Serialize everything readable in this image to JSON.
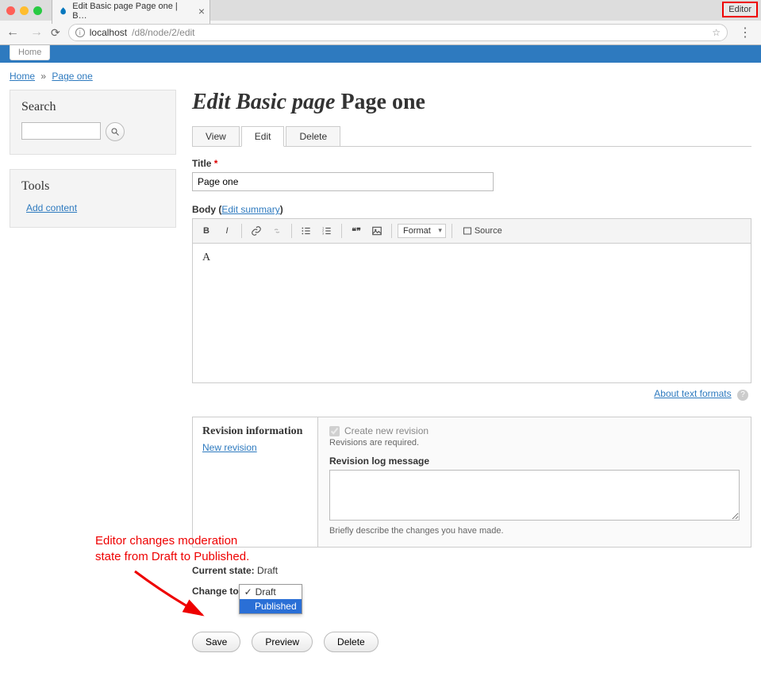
{
  "browser": {
    "tab_title": "Edit Basic page Page one | B…",
    "url_host": "localhost",
    "url_path": "/d8/node/2/edit",
    "editor_badge": "Editor"
  },
  "toolbar": {
    "home": "Home"
  },
  "breadcrumb": {
    "home": "Home",
    "sep": "»",
    "page": "Page one"
  },
  "sidebar": {
    "search": {
      "heading": "Search"
    },
    "tools": {
      "heading": "Tools",
      "add_content": "Add content"
    }
  },
  "page": {
    "title_prefix": "Edit Basic page",
    "title_suffix": "Page one",
    "tabs": {
      "view": "View",
      "edit": "Edit",
      "delete": "Delete"
    },
    "title_field": {
      "label": "Title",
      "value": "Page one"
    },
    "body": {
      "label": "Body",
      "summary_link": "Edit summary",
      "format_label": "Format",
      "source_label": "Source",
      "content": "A",
      "about_formats": "About text formats"
    },
    "revision": {
      "heading": "Revision information",
      "new_revision_link": "New revision",
      "checkbox_label": "Create new revision",
      "required_text": "Revisions are required.",
      "log_label": "Revision log message",
      "log_desc": "Briefly describe the changes you have made."
    },
    "moderation": {
      "current_label": "Current state:",
      "current_value": "Draft",
      "change_label": "Change to",
      "option_draft": "Draft",
      "option_published": "Published"
    },
    "actions": {
      "save": "Save",
      "preview": "Preview",
      "delete": "Delete"
    }
  },
  "annotation": {
    "line1": "Editor changes moderation",
    "line2": "state from Draft to Published."
  }
}
